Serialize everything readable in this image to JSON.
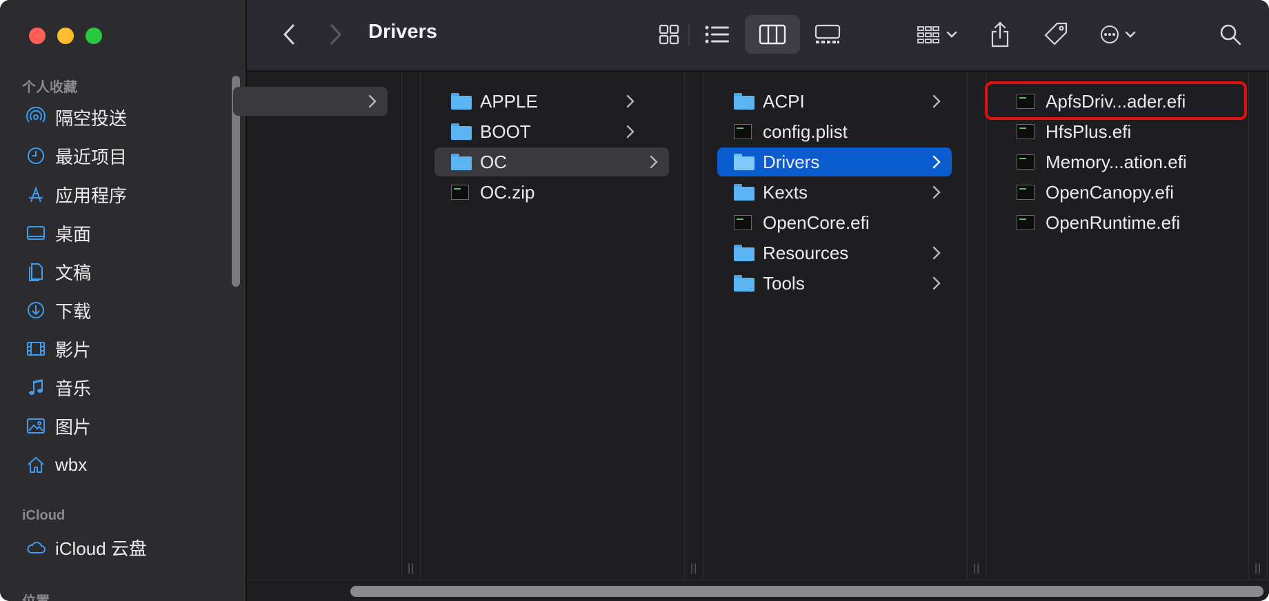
{
  "window": {
    "title": "Drivers"
  },
  "sidebar": {
    "favorites_header": "个人收藏",
    "favorites": [
      {
        "label": "隔空投送",
        "icon": "airdrop-icon"
      },
      {
        "label": "最近项目",
        "icon": "clock-icon"
      },
      {
        "label": "应用程序",
        "icon": "applications-icon"
      },
      {
        "label": "桌面",
        "icon": "desktop-icon"
      },
      {
        "label": "文稿",
        "icon": "documents-icon"
      },
      {
        "label": "下载",
        "icon": "download-icon"
      },
      {
        "label": "影片",
        "icon": "movies-icon"
      },
      {
        "label": "音乐",
        "icon": "music-icon"
      },
      {
        "label": "图片",
        "icon": "pictures-icon"
      },
      {
        "label": "wbx",
        "icon": "home-icon"
      }
    ],
    "icloud_header": "iCloud",
    "icloud": [
      {
        "label": "iCloud 云盘",
        "icon": "cloud-icon"
      }
    ],
    "locations_header": "位置"
  },
  "columns": {
    "col2": [
      {
        "label": "APPLE",
        "type": "folder"
      },
      {
        "label": "BOOT",
        "type": "folder"
      },
      {
        "label": "OC",
        "type": "folder",
        "selected": "grey"
      },
      {
        "label": "OC.zip",
        "type": "file"
      }
    ],
    "col3": [
      {
        "label": "ACPI",
        "type": "folder"
      },
      {
        "label": "config.plist",
        "type": "file"
      },
      {
        "label": "Drivers",
        "type": "folder",
        "selected": "blue"
      },
      {
        "label": "Kexts",
        "type": "folder"
      },
      {
        "label": "OpenCore.efi",
        "type": "file"
      },
      {
        "label": "Resources",
        "type": "folder"
      },
      {
        "label": "Tools",
        "type": "folder"
      }
    ],
    "col4": [
      {
        "label": "ApfsDriv...ader.efi",
        "type": "file",
        "highlighted": true
      },
      {
        "label": "HfsPlus.efi",
        "type": "file"
      },
      {
        "label": "Memory...ation.efi",
        "type": "file"
      },
      {
        "label": "OpenCanopy.efi",
        "type": "file"
      },
      {
        "label": "OpenRuntime.efi",
        "type": "file"
      }
    ]
  },
  "colors": {
    "highlight_box": "#e0100e",
    "selection_blue": "#0a5ccf",
    "accent_icon": "#3d9cf0"
  }
}
